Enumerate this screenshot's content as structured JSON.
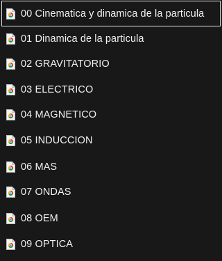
{
  "file_list": {
    "items": [
      {
        "label": "00 Cinematica y dinamica de la particula",
        "icon": "chrome-document-icon",
        "selected": true
      },
      {
        "label": "01 Dinamica de la particula",
        "icon": "chrome-document-icon",
        "selected": false
      },
      {
        "label": "02 GRAVITATORIO",
        "icon": "chrome-document-icon",
        "selected": false
      },
      {
        "label": "03 ELECTRICO",
        "icon": "chrome-document-icon",
        "selected": false
      },
      {
        "label": "04 MAGNETICO",
        "icon": "chrome-document-icon",
        "selected": false
      },
      {
        "label": "05 INDUCCION",
        "icon": "chrome-document-icon",
        "selected": false
      },
      {
        "label": "06 MAS",
        "icon": "chrome-document-icon",
        "selected": false
      },
      {
        "label": "07 ONDAS",
        "icon": "chrome-document-icon",
        "selected": false
      },
      {
        "label": "08 OEM",
        "icon": "chrome-document-icon",
        "selected": false
      },
      {
        "label": "09 OPTICA",
        "icon": "chrome-document-icon",
        "selected": false
      }
    ]
  },
  "colors": {
    "background": "#181818",
    "text": "#f2f2f2",
    "selection_border": "#e8e8e8"
  }
}
